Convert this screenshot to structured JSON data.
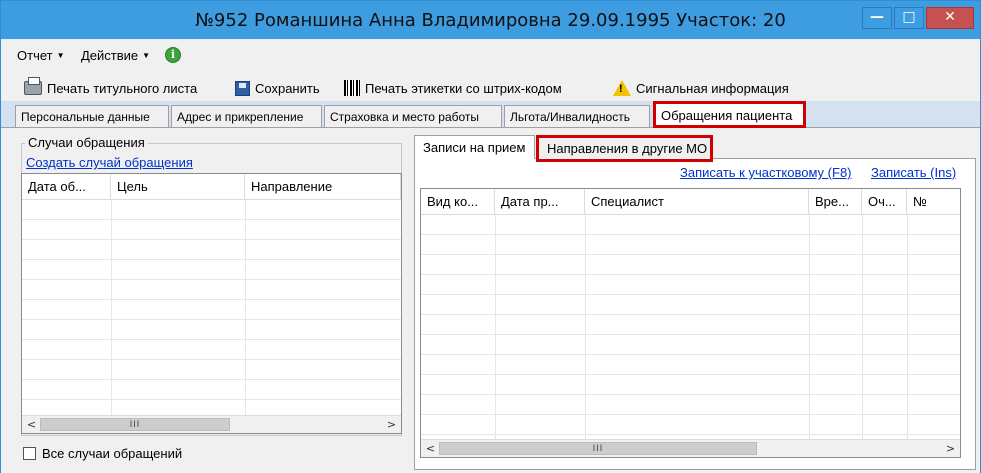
{
  "window": {
    "title": "№952 Романшина Анна Владимировна 29.09.1995 Участок: 20",
    "controls": {
      "minimize": "—",
      "maximize": "□",
      "close": "✕"
    }
  },
  "menu": {
    "items": [
      {
        "label": "Отчет"
      },
      {
        "label": "Действие"
      }
    ],
    "info_icon": "info-icon"
  },
  "toolbar": {
    "items": [
      {
        "icon": "printer-icon",
        "label": "Печать титульного листа"
      },
      {
        "icon": "floppy-disk-icon",
        "label": "Сохранить"
      },
      {
        "icon": "barcode-icon",
        "label": "Печать этикетки со штрих-кодом"
      },
      {
        "icon": "warning-icon",
        "label": "Сигнальная информация"
      }
    ]
  },
  "tabs": [
    {
      "label": "Персональные данные"
    },
    {
      "label": "Адрес и прикрепление"
    },
    {
      "label": "Страховка и место работы"
    },
    {
      "label": "Льгота/Инвалидность"
    },
    {
      "label": "Обращения пациента",
      "active": true
    }
  ],
  "left": {
    "group_label": "Случаи обращения",
    "create_link": "Создать случай обращения",
    "columns": [
      "Дата об...",
      "Цель",
      "Направление"
    ],
    "scroll_thumb": "III",
    "all_cases_checkbox": "Все случаи обращений",
    "all_cases_checked": false
  },
  "right": {
    "subtabs": [
      {
        "label": "Записи на прием",
        "selected": true
      },
      {
        "label": "Направления в другие МО",
        "highlighted": true
      }
    ],
    "links": [
      "Записать к участковому (F8)",
      "Записать (Ins)"
    ],
    "columns": [
      "Вид ко...",
      "Дата пр...",
      "Специалист",
      "Вре...",
      "Оч...",
      "№"
    ],
    "scroll_thumb": "III"
  },
  "colors": {
    "titlebar": "#3e9de0",
    "highlight": "#d00000",
    "link": "#0033cc",
    "tabsbar": "#d3e1f0"
  }
}
